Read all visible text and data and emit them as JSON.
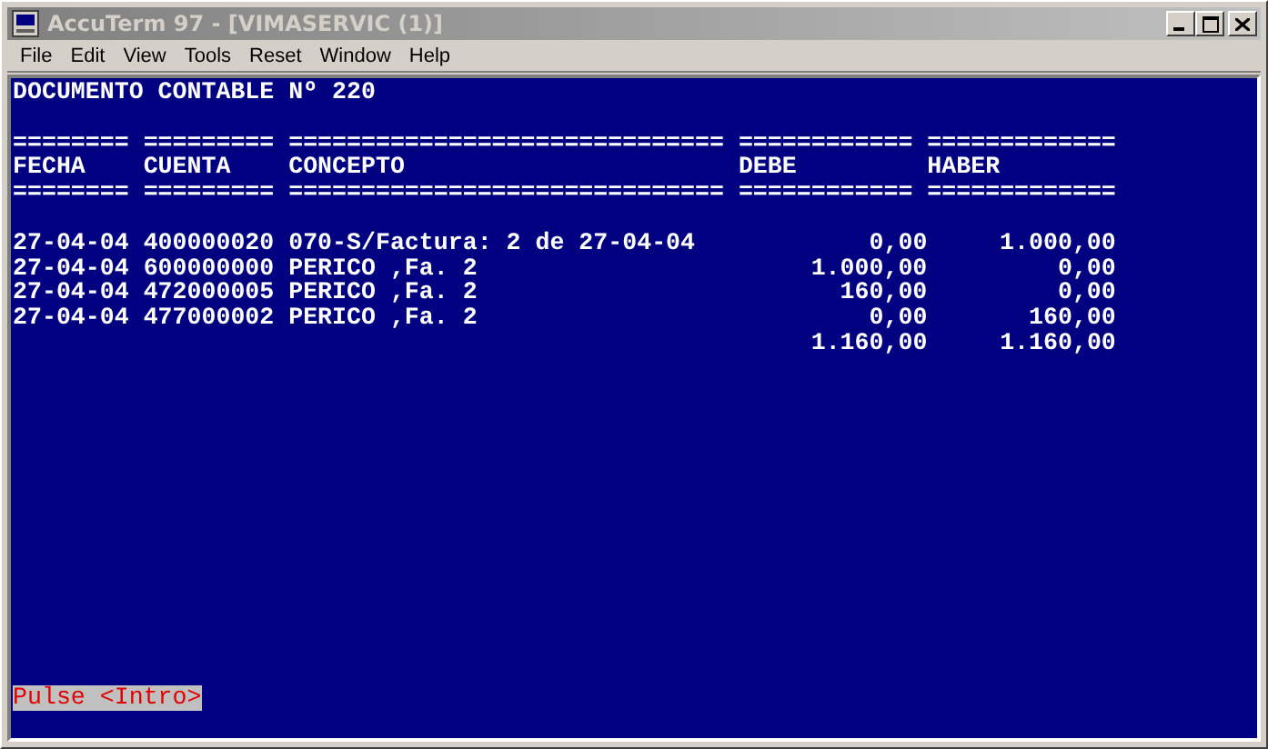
{
  "window": {
    "title": "AccuTerm 97 - [VIMASERVIC (1)]"
  },
  "menu": [
    "File",
    "Edit",
    "View",
    "Tools",
    "Reset",
    "Window",
    "Help"
  ],
  "terminal": {
    "title": "DOCUMENTO CONTABLE Nº 220",
    "columns": [
      {
        "label": "FECHA",
        "rule_above": "========",
        "rule_below": "========",
        "kind": "text"
      },
      {
        "label": "CUENTA",
        "rule_above": "=========",
        "rule_below": "=========",
        "kind": "text"
      },
      {
        "label": "CONCEPTO",
        "rule_above": "==============================",
        "rule_below": "==============================",
        "kind": "text"
      },
      {
        "label": "DEBE",
        "rule_above": "============",
        "rule_below": "============",
        "kind": "amount"
      },
      {
        "label": "HABER",
        "rule_above": "=============",
        "rule_below": "=============",
        "kind": "amount"
      }
    ],
    "rows": [
      [
        "27-04-04",
        "400000020",
        "070-S/Factura: 2 de 27-04-04",
        "0,00",
        "1.000,00"
      ],
      [
        "27-04-04",
        "600000000",
        "PERICO ,Fa. 2",
        "1.000,00",
        "0,00"
      ],
      [
        "27-04-04",
        "472000005",
        "PERICO ,Fa. 2",
        "160,00",
        "0,00"
      ],
      [
        "27-04-04",
        "477000002",
        "PERICO ,Fa. 2",
        "0,00",
        "160,00"
      ]
    ],
    "totals": [
      "1.160,00",
      "1.160,00"
    ],
    "prompt": "Pulse <Intro>"
  }
}
